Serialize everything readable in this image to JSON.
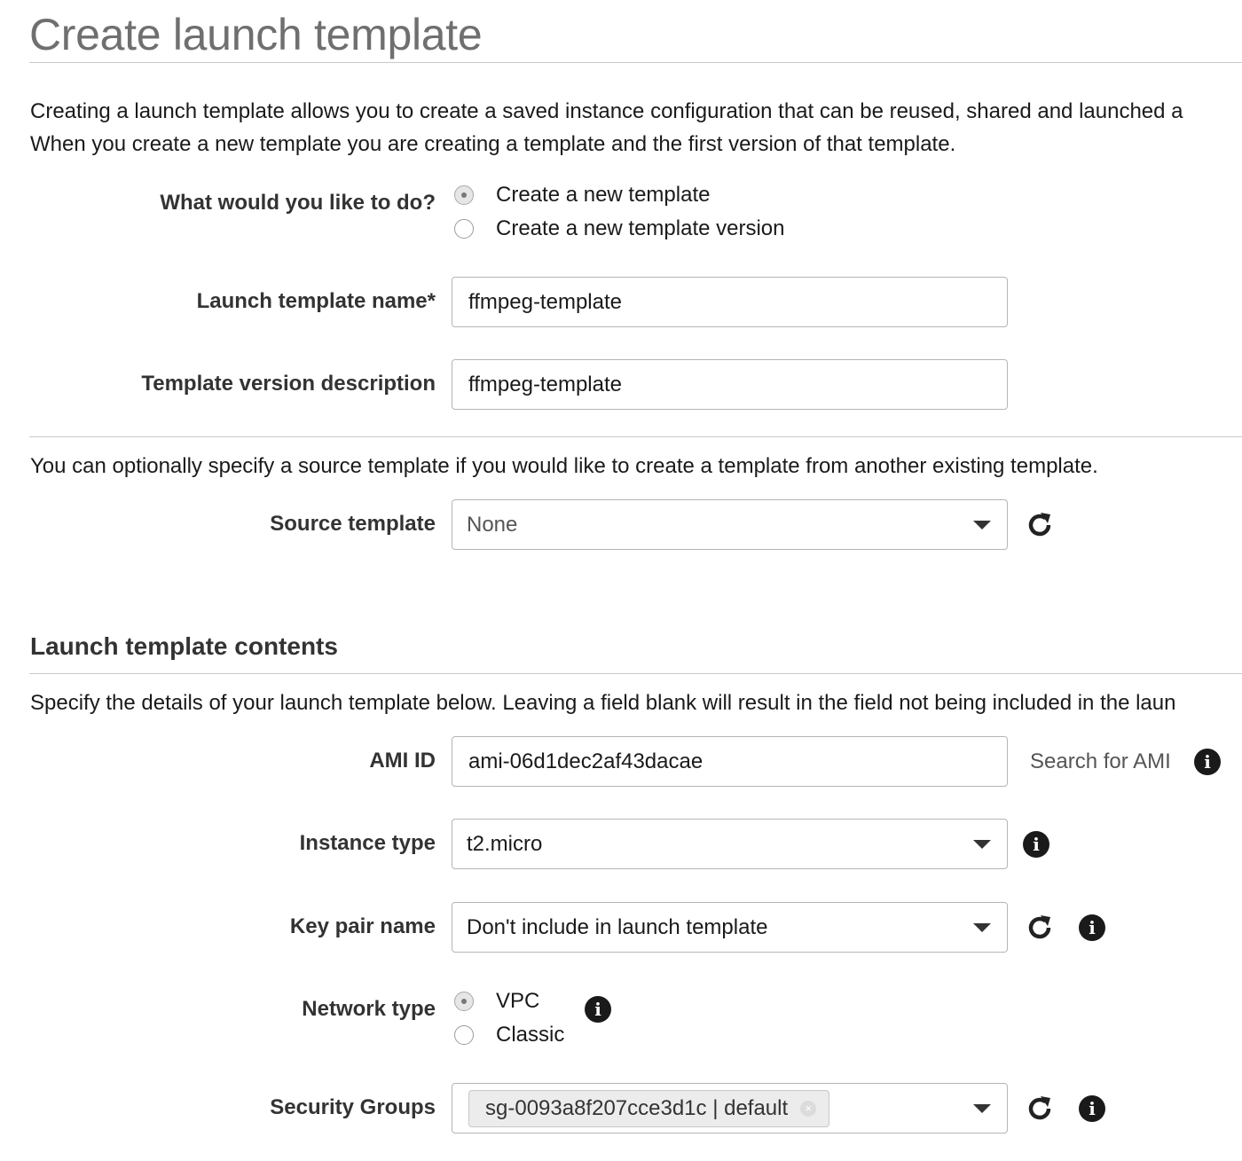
{
  "page": {
    "title": "Create launch template",
    "intro_line1": "Creating a launch template allows you to create a saved instance configuration that can be reused, shared and launched a",
    "intro_line2": "When you create a new template you are creating a template and the first version of that template."
  },
  "action": {
    "label": "What would you like to do?",
    "options": [
      {
        "label": "Create a new template",
        "selected": true
      },
      {
        "label": "Create a new template version",
        "selected": false
      }
    ]
  },
  "template_name": {
    "label": "Launch template name*",
    "value": "ffmpeg-template"
  },
  "version_description": {
    "label": "Template version description",
    "value": "ffmpeg-template"
  },
  "source": {
    "note": "You can optionally specify a source template if you would like to create a template from another existing template.",
    "label": "Source template",
    "value": "None",
    "refresh_icon": "refresh-icon"
  },
  "contents": {
    "title": "Launch template contents",
    "note": "Specify the details of your launch template below. Leaving a field blank will result in the field not being included in the laun"
  },
  "ami": {
    "label": "AMI ID",
    "value": "ami-06d1dec2af43dacae",
    "search_label": "Search for AMI",
    "info_icon": "info-icon"
  },
  "instance_type": {
    "label": "Instance type",
    "value": "t2.micro"
  },
  "key_pair": {
    "label": "Key pair name",
    "value": "Don't include in launch template"
  },
  "network": {
    "label": "Network type",
    "options": [
      {
        "label": "VPC",
        "selected": true
      },
      {
        "label": "Classic",
        "selected": false
      }
    ]
  },
  "security_groups": {
    "label": "Security Groups",
    "selected_token": "sg-0093a8f207cce3d1c | default",
    "remove_glyph": "×"
  },
  "icons": {
    "info_glyph": "i",
    "refresh_glyph": "refresh"
  }
}
